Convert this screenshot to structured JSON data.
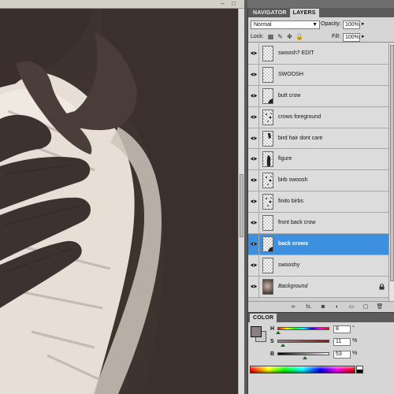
{
  "canvas": {
    "description_colors": {
      "skin_dark": "#3f3330",
      "paper_light": "#e9e1d8"
    }
  },
  "window_buttons": {
    "minimize": "–",
    "restore": "□"
  },
  "layers_panel": {
    "tabs": [
      {
        "label": "NAVIGATOR",
        "active": false
      },
      {
        "label": "LAYERS",
        "active": true
      }
    ],
    "blend_mode": "Normal",
    "opacity_label": "Opacity:",
    "opacity_value": "100%",
    "lock_label": "Lock:",
    "fill_label": "Fill:",
    "fill_value": "100%",
    "selected_color": "#3d8fe0",
    "layers": [
      {
        "name": "swoosh? EDIT",
        "visible": true,
        "selected": false,
        "thumb": "empty"
      },
      {
        "name": "SWOOSH",
        "visible": true,
        "selected": false,
        "thumb": "empty"
      },
      {
        "name": "butt crow",
        "visible": true,
        "selected": false,
        "thumb": "corner"
      },
      {
        "name": "crows foreground",
        "visible": true,
        "selected": false,
        "thumb": "specks"
      },
      {
        "name": "bird hair dont care",
        "visible": true,
        "selected": false,
        "thumb": "tuft"
      },
      {
        "name": "figure",
        "visible": true,
        "selected": false,
        "thumb": "figure"
      },
      {
        "name": "birb swoosh",
        "visible": true,
        "selected": false,
        "thumb": "specks"
      },
      {
        "name": "finito birbs",
        "visible": true,
        "selected": false,
        "thumb": "specks"
      },
      {
        "name": "front back crow",
        "visible": true,
        "selected": false,
        "thumb": "empty"
      },
      {
        "name": "back crows",
        "visible": true,
        "selected": true,
        "thumb": "corner"
      },
      {
        "name": "swooshy",
        "visible": true,
        "selected": false,
        "thumb": "empty"
      },
      {
        "name": "Background",
        "visible": true,
        "selected": false,
        "thumb": "background",
        "locked": true
      }
    ],
    "footer_icons": [
      "link-icon",
      "fx-icon",
      "mask-icon",
      "adjustment-icon",
      "group-icon",
      "new-layer-icon",
      "trash-icon"
    ],
    "footer_glyphs": {
      "link": "∞",
      "fx": "fx.",
      "mask": "◙",
      "adjustment": "◐",
      "group": "▭",
      "new_layer": "▢",
      "trash": "🗑"
    }
  },
  "color_panel": {
    "tabs": [
      {
        "label": "COLOR",
        "active": true
      }
    ],
    "foreground": "#8b7f7f",
    "background": "#c9c9c9",
    "channels": [
      {
        "label": "H",
        "value": "8",
        "unit": "°",
        "level": 0.02
      },
      {
        "label": "S",
        "value": "11",
        "unit": "%",
        "level": 0.11
      },
      {
        "label": "B",
        "value": "53",
        "unit": "%",
        "level": 0.53
      }
    ]
  }
}
